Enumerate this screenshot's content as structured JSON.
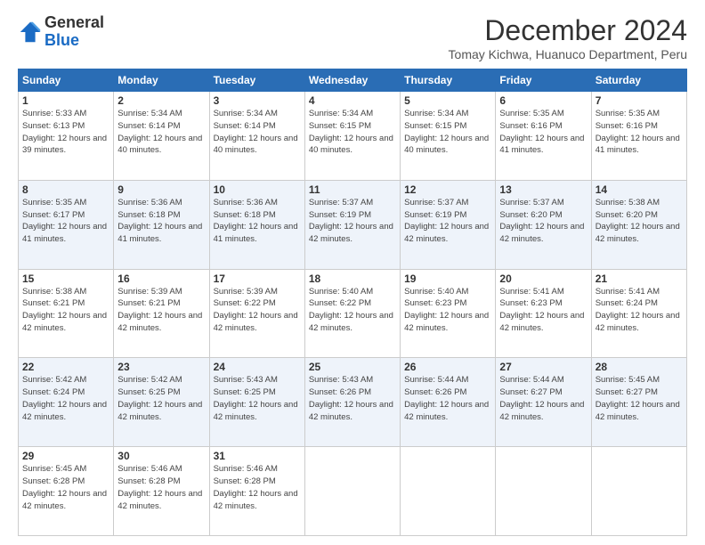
{
  "header": {
    "logo_general": "General",
    "logo_blue": "Blue",
    "month_title": "December 2024",
    "subtitle": "Tomay Kichwa, Huanuco Department, Peru"
  },
  "days_of_week": [
    "Sunday",
    "Monday",
    "Tuesday",
    "Wednesday",
    "Thursday",
    "Friday",
    "Saturday"
  ],
  "weeks": [
    [
      {
        "day": "1",
        "sunrise": "5:33 AM",
        "sunset": "6:13 PM",
        "daylight": "12 hours and 39 minutes."
      },
      {
        "day": "2",
        "sunrise": "5:34 AM",
        "sunset": "6:14 PM",
        "daylight": "12 hours and 40 minutes."
      },
      {
        "day": "3",
        "sunrise": "5:34 AM",
        "sunset": "6:14 PM",
        "daylight": "12 hours and 40 minutes."
      },
      {
        "day": "4",
        "sunrise": "5:34 AM",
        "sunset": "6:15 PM",
        "daylight": "12 hours and 40 minutes."
      },
      {
        "day": "5",
        "sunrise": "5:34 AM",
        "sunset": "6:15 PM",
        "daylight": "12 hours and 40 minutes."
      },
      {
        "day": "6",
        "sunrise": "5:35 AM",
        "sunset": "6:16 PM",
        "daylight": "12 hours and 41 minutes."
      },
      {
        "day": "7",
        "sunrise": "5:35 AM",
        "sunset": "6:16 PM",
        "daylight": "12 hours and 41 minutes."
      }
    ],
    [
      {
        "day": "8",
        "sunrise": "5:35 AM",
        "sunset": "6:17 PM",
        "daylight": "12 hours and 41 minutes."
      },
      {
        "day": "9",
        "sunrise": "5:36 AM",
        "sunset": "6:18 PM",
        "daylight": "12 hours and 41 minutes."
      },
      {
        "day": "10",
        "sunrise": "5:36 AM",
        "sunset": "6:18 PM",
        "daylight": "12 hours and 41 minutes."
      },
      {
        "day": "11",
        "sunrise": "5:37 AM",
        "sunset": "6:19 PM",
        "daylight": "12 hours and 42 minutes."
      },
      {
        "day": "12",
        "sunrise": "5:37 AM",
        "sunset": "6:19 PM",
        "daylight": "12 hours and 42 minutes."
      },
      {
        "day": "13",
        "sunrise": "5:37 AM",
        "sunset": "6:20 PM",
        "daylight": "12 hours and 42 minutes."
      },
      {
        "day": "14",
        "sunrise": "5:38 AM",
        "sunset": "6:20 PM",
        "daylight": "12 hours and 42 minutes."
      }
    ],
    [
      {
        "day": "15",
        "sunrise": "5:38 AM",
        "sunset": "6:21 PM",
        "daylight": "12 hours and 42 minutes."
      },
      {
        "day": "16",
        "sunrise": "5:39 AM",
        "sunset": "6:21 PM",
        "daylight": "12 hours and 42 minutes."
      },
      {
        "day": "17",
        "sunrise": "5:39 AM",
        "sunset": "6:22 PM",
        "daylight": "12 hours and 42 minutes."
      },
      {
        "day": "18",
        "sunrise": "5:40 AM",
        "sunset": "6:22 PM",
        "daylight": "12 hours and 42 minutes."
      },
      {
        "day": "19",
        "sunrise": "5:40 AM",
        "sunset": "6:23 PM",
        "daylight": "12 hours and 42 minutes."
      },
      {
        "day": "20",
        "sunrise": "5:41 AM",
        "sunset": "6:23 PM",
        "daylight": "12 hours and 42 minutes."
      },
      {
        "day": "21",
        "sunrise": "5:41 AM",
        "sunset": "6:24 PM",
        "daylight": "12 hours and 42 minutes."
      }
    ],
    [
      {
        "day": "22",
        "sunrise": "5:42 AM",
        "sunset": "6:24 PM",
        "daylight": "12 hours and 42 minutes."
      },
      {
        "day": "23",
        "sunrise": "5:42 AM",
        "sunset": "6:25 PM",
        "daylight": "12 hours and 42 minutes."
      },
      {
        "day": "24",
        "sunrise": "5:43 AM",
        "sunset": "6:25 PM",
        "daylight": "12 hours and 42 minutes."
      },
      {
        "day": "25",
        "sunrise": "5:43 AM",
        "sunset": "6:26 PM",
        "daylight": "12 hours and 42 minutes."
      },
      {
        "day": "26",
        "sunrise": "5:44 AM",
        "sunset": "6:26 PM",
        "daylight": "12 hours and 42 minutes."
      },
      {
        "day": "27",
        "sunrise": "5:44 AM",
        "sunset": "6:27 PM",
        "daylight": "12 hours and 42 minutes."
      },
      {
        "day": "28",
        "sunrise": "5:45 AM",
        "sunset": "6:27 PM",
        "daylight": "12 hours and 42 minutes."
      }
    ],
    [
      {
        "day": "29",
        "sunrise": "5:45 AM",
        "sunset": "6:28 PM",
        "daylight": "12 hours and 42 minutes."
      },
      {
        "day": "30",
        "sunrise": "5:46 AM",
        "sunset": "6:28 PM",
        "daylight": "12 hours and 42 minutes."
      },
      {
        "day": "31",
        "sunrise": "5:46 AM",
        "sunset": "6:28 PM",
        "daylight": "12 hours and 42 minutes."
      },
      null,
      null,
      null,
      null
    ]
  ],
  "labels": {
    "sunrise_prefix": "Sunrise: ",
    "sunset_prefix": "Sunset: ",
    "daylight_prefix": "Daylight: "
  }
}
